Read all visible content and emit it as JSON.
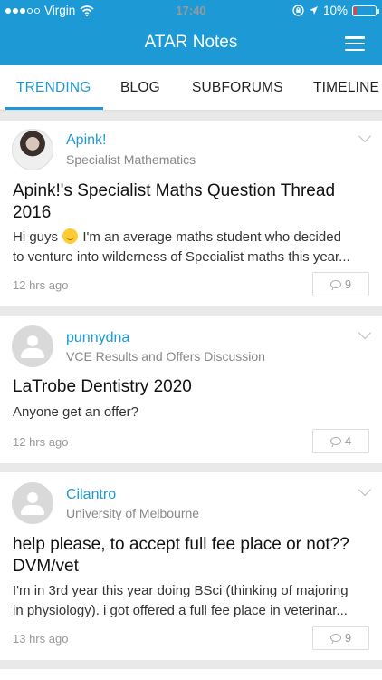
{
  "status": {
    "carrier": "Virgin",
    "time": "17:40",
    "battery": "10%",
    "signal_bars": 3,
    "battery_level": 0.1
  },
  "header": {
    "title": "ATAR Notes"
  },
  "tabs": [
    {
      "label": "TRENDING",
      "active": true
    },
    {
      "label": "BLOG",
      "active": false
    },
    {
      "label": "SUBFORUMS",
      "active": false
    },
    {
      "label": "TIMELINE",
      "active": false
    }
  ],
  "posts": [
    {
      "user": "Apink!",
      "forum": "Specialist Mathematics",
      "title_line1": "Apink!'s Specialist Maths Question Thread",
      "title_line2": "2016",
      "excerpt_part1": "Hi guys",
      "excerpt_part2": "I'm an average maths student who decided",
      "excerpt_line2": "to venture into wilderness of Specialist maths this year...",
      "time": "12 hrs ago",
      "comments": "9",
      "avatar_type": "photo"
    },
    {
      "user": "punnydna",
      "forum": "VCE Results and Offers Discussion",
      "title_line1": "LaTrobe Dentistry 2020",
      "excerpt_line1": "Anyone get an offer?",
      "time": "12 hrs ago",
      "comments": "4",
      "avatar_type": "default"
    },
    {
      "user": "Cilantro",
      "forum": "University of Melbourne",
      "title_line1": "help please, to accept full fee place or not??",
      "title_line2": "DVM/vet",
      "excerpt_line1": "I'm in 3rd year this year doing BSci (thinking of majoring",
      "excerpt_line2": "in physiology). i got offered a full fee place in veterinar...",
      "time": "13 hrs ago",
      "comments": "9",
      "avatar_type": "default"
    }
  ],
  "colors": {
    "accent": "#1d9ad6",
    "battery_low": "#ff3b30",
    "background": "#e9e9e9"
  },
  "icons": [
    "wifi-icon",
    "lock-rotation-icon",
    "location-arrow-icon",
    "battery-icon",
    "menu-icon",
    "chevron-down-icon",
    "comment-icon",
    "smile-emoji-icon"
  ]
}
